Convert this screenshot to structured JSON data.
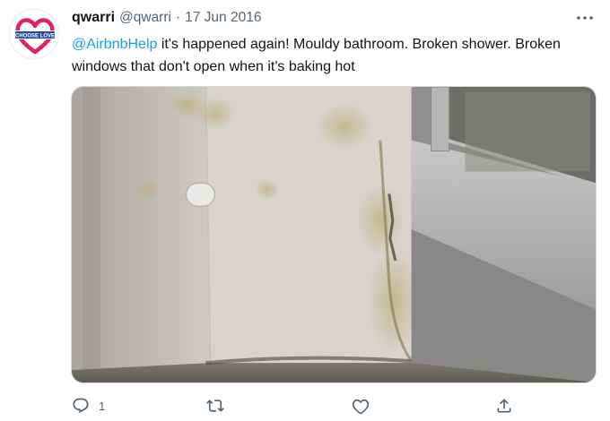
{
  "tweet": {
    "author": {
      "display_name": "qwarri",
      "handle": "@qwarri",
      "avatar_icon": "heart-logo-icon",
      "avatar_text": "CHOOSE LOVE",
      "avatar_color": "#e0245e"
    },
    "separator": "·",
    "date": "17 Jun 2016",
    "body": {
      "mention": "@AirbnbHelp",
      "text": " it's happened again! Mouldy bathroom. Broken shower. Broken windows that don't open when it's baking hot"
    },
    "media": {
      "type": "photo",
      "description_icon": "mouldy-bathroom-photo"
    },
    "actions": {
      "reply_count": "1",
      "reply_icon": "reply-icon",
      "retweet_icon": "retweet-icon",
      "like_icon": "heart-icon",
      "share_icon": "share-icon"
    },
    "more_icon": "more-options-icon"
  },
  "colors": {
    "link": "#1d9bf0",
    "secondary_text": "#536471",
    "primary_text": "#0f1419"
  }
}
